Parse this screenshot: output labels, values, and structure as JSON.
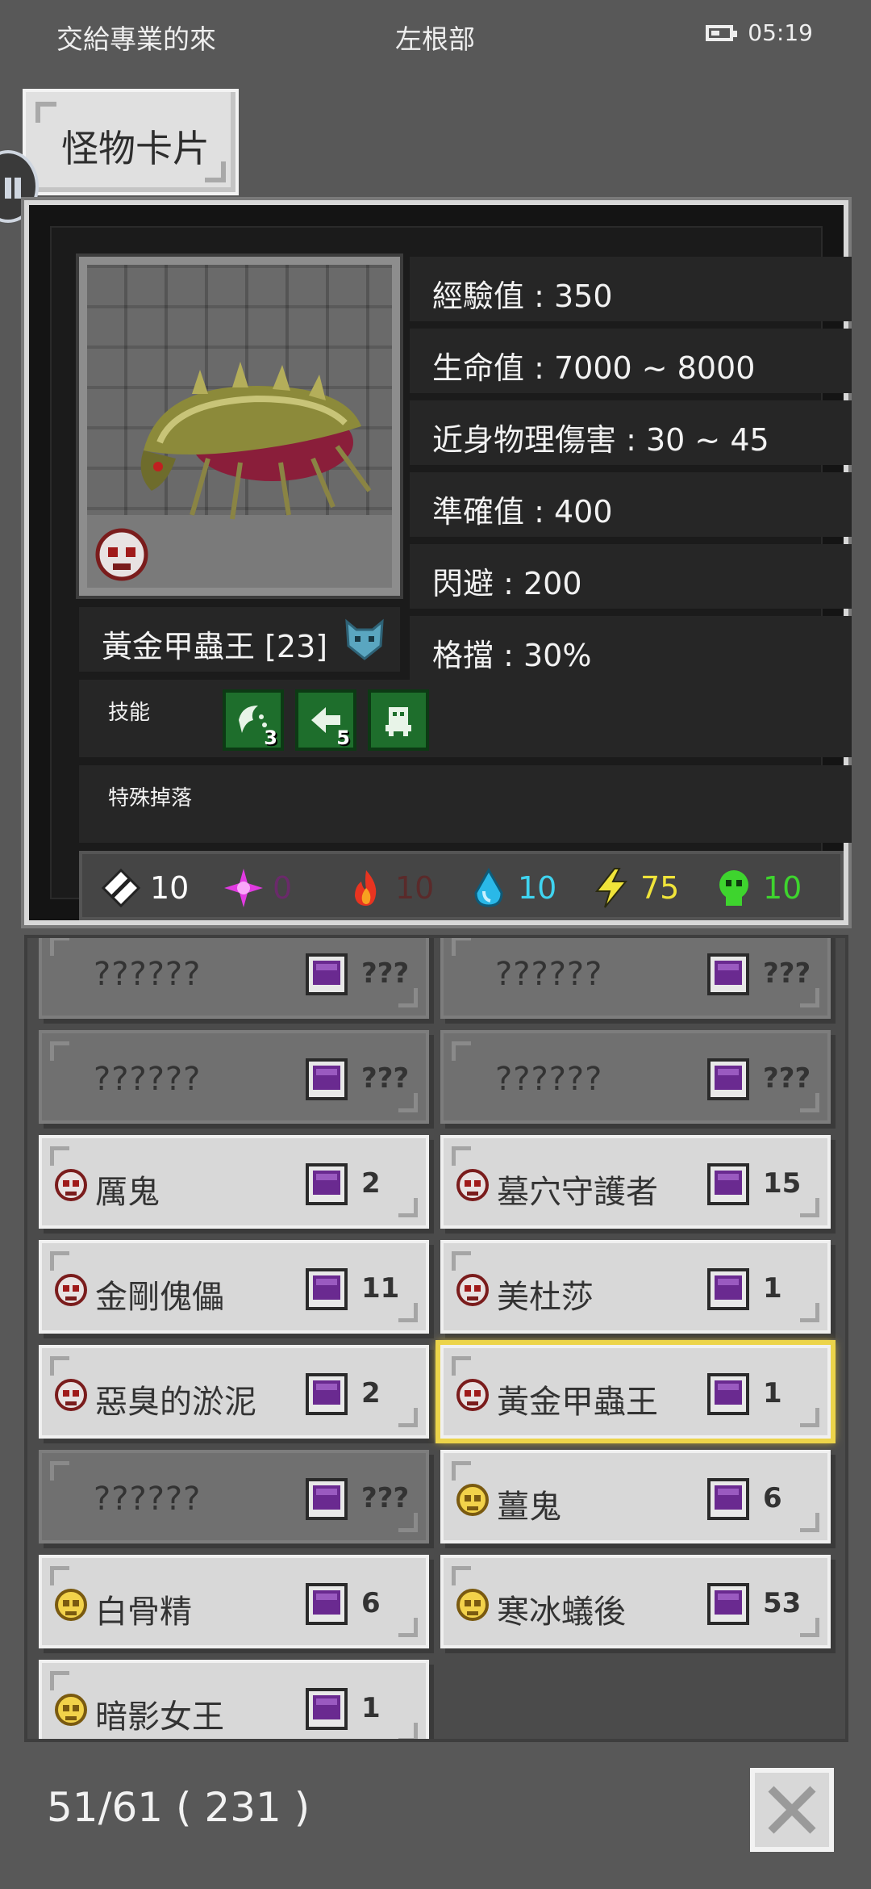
{
  "status_bar": {
    "left_text": "交給專業的來",
    "center_text": "左根部",
    "time": "05:19"
  },
  "title": "怪物卡片",
  "monster": {
    "name": "黃金甲蟲王 [23]",
    "stats": [
      "經驗值 : 350",
      "生命值 : 7000 ~ 8000",
      "近身物理傷害 : 30 ~ 45",
      "準確值 : 400",
      "閃避 : 200",
      "格擋 : 30%"
    ],
    "skills_label": "技能",
    "skills": [
      {
        "icon": "wind-slash-icon",
        "level": "3"
      },
      {
        "icon": "arrow-burst-icon",
        "level": "5"
      },
      {
        "icon": "monster-summon-icon",
        "level": ""
      }
    ],
    "drops_label": "特殊掉落",
    "elements": [
      {
        "icon": "physical-icon",
        "value": "10",
        "color": "#ffffff"
      },
      {
        "icon": "arcane-icon",
        "value": "0",
        "color": "#6a2a6a"
      },
      {
        "icon": "fire-icon",
        "value": "10",
        "color": "#5a2a2a"
      },
      {
        "icon": "water-icon",
        "value": "10",
        "color": "#3fd4f0"
      },
      {
        "icon": "lightning-icon",
        "value": "75",
        "color": "#f0e43a"
      },
      {
        "icon": "poison-icon",
        "value": "10",
        "color": "#3ed42e"
      }
    ]
  },
  "list": [
    {
      "name": "??????",
      "count": "???",
      "type": "unknown"
    },
    {
      "name": "??????",
      "count": "???",
      "type": "unknown"
    },
    {
      "name": "??????",
      "count": "???",
      "type": "unknown"
    },
    {
      "name": "??????",
      "count": "???",
      "type": "unknown"
    },
    {
      "name": "厲鬼",
      "count": "2",
      "type": "red"
    },
    {
      "name": "墓穴守護者",
      "count": "15",
      "type": "red"
    },
    {
      "name": "金剛傀儡",
      "count": "11",
      "type": "red"
    },
    {
      "name": "美杜莎",
      "count": "1",
      "type": "red"
    },
    {
      "name": "惡臭的淤泥",
      "count": "2",
      "type": "red"
    },
    {
      "name": "黃金甲蟲王",
      "count": "1",
      "type": "red",
      "selected": true
    },
    {
      "name": "??????",
      "count": "???",
      "type": "unknown"
    },
    {
      "name": "薑鬼",
      "count": "6",
      "type": "gold"
    },
    {
      "name": "白骨精",
      "count": "6",
      "type": "gold"
    },
    {
      "name": "寒冰蟻後",
      "count": "53",
      "type": "gold"
    },
    {
      "name": "暗影女王",
      "count": "1",
      "type": "gold"
    }
  ],
  "footer": {
    "progress": "51/61 ( 231 )"
  }
}
